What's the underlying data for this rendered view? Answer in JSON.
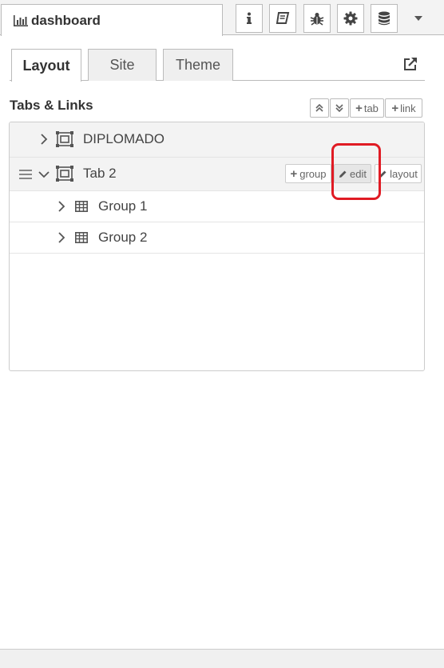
{
  "header": {
    "tab_title": "dashboard",
    "tab_icon": "bar-chart-icon",
    "tools": [
      {
        "name": "info-icon"
      },
      {
        "name": "book-icon"
      },
      {
        "name": "bug-icon"
      },
      {
        "name": "gear-icon"
      },
      {
        "name": "database-icon"
      }
    ],
    "menu_icon": "chevron-down-icon"
  },
  "subtabs": [
    {
      "label": "Layout",
      "active": true
    },
    {
      "label": "Site",
      "active": false
    },
    {
      "label": "Theme",
      "active": false
    }
  ],
  "section": {
    "title": "Tabs & Links",
    "buttons": {
      "expand_icon": "double-chevron-up-icon",
      "collapse_icon": "double-chevron-down-icon",
      "tab": "tab",
      "link": "link"
    }
  },
  "tree": {
    "tabs": [
      {
        "name": "DIPLOMADO",
        "expanded": false
      },
      {
        "name": "Tab 2",
        "expanded": true,
        "actions": {
          "group": "group",
          "edit": "edit",
          "layout": "layout"
        },
        "groups": [
          {
            "name": "Group 1"
          },
          {
            "name": "Group 2"
          }
        ]
      }
    ]
  },
  "colors": {
    "highlight": "#e01b24",
    "border": "#bbbbbb",
    "row_bg": "#f3f3f3"
  }
}
